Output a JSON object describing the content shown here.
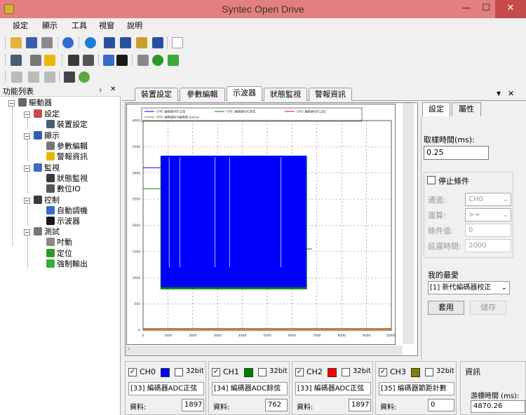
{
  "window": {
    "title": "Syntec Open Drive",
    "minimize": "—",
    "maximize": "☐",
    "close": "✕"
  },
  "menu": [
    "設定",
    "顯示",
    "工具",
    "視窗",
    "說明"
  ],
  "left_panel": {
    "title": "功能列表",
    "pin": "ₜ",
    "close": "✕",
    "tree": {
      "root": "驅動器",
      "groups": [
        {
          "label": "設定",
          "items": [
            "裝置設定"
          ]
        },
        {
          "label": "顯示",
          "items": [
            "參數編輯",
            "警報資訊"
          ]
        },
        {
          "label": "監視",
          "items": [
            "狀態監視",
            "數位IO"
          ]
        },
        {
          "label": "控制",
          "items": [
            "自動調機",
            "示波器"
          ]
        },
        {
          "label": "測試",
          "items": [
            "吋動",
            "定位",
            "強制輸出"
          ]
        }
      ]
    }
  },
  "doc_tabs": [
    "裝置設定",
    "參數編輯",
    "示波器",
    "狀態監視",
    "警報資訊"
  ],
  "doc_controls": {
    "dropdown": "▾",
    "close": "✕"
  },
  "oscilloscope": {
    "legend": [
      "CH0: 編碼器ADC正弦",
      "CH1: 編碼器ADC餘弦",
      "CH2: 編碼器ADC正弦",
      "CH3: 編碼器新代編碼器 (pulse)"
    ]
  },
  "chart_data": {
    "type": "line",
    "x_ticks": [
      0,
      1000,
      2000,
      3000,
      4000,
      5000,
      6000,
      7000,
      8000,
      9000,
      10000
    ],
    "y_ticks": [
      0,
      500,
      1000,
      1500,
      2000,
      2500,
      3000,
      3500,
      4000
    ],
    "xlim": [
      0,
      10000
    ],
    "ylim": [
      0,
      4000
    ],
    "grid": true,
    "legend_position": "top",
    "series": [
      {
        "name": "CH0",
        "color": "#0000ff",
        "x": [
          0,
          700,
          800,
          6500,
          6600
        ],
        "y": [
          3100,
          3100,
          800,
          3300,
          850
        ]
      },
      {
        "name": "CH1",
        "color": "#008000",
        "x": [
          0,
          700,
          800,
          6600,
          6800
        ],
        "y": [
          2700,
          2700,
          800,
          800,
          1550
        ]
      },
      {
        "name": "CH2",
        "color": "#ff0000",
        "x": [
          0,
          10000
        ],
        "y": [
          0,
          0
        ]
      },
      {
        "name": "CH3",
        "color": "#808000",
        "x": [
          0,
          10000
        ],
        "y": [
          30,
          30
        ]
      }
    ]
  },
  "right_panel": {
    "tabs": [
      "設定",
      "屬性"
    ],
    "sample_label": "取樣時間(ms):",
    "sample_value": "0.25",
    "stop_label": "停止條件",
    "channel_label": "通道:",
    "channel_value": "CH0",
    "op_label": "運算:",
    "op_value": ">=",
    "cond_label": "條件值:",
    "cond_value": "0",
    "delay_label": "延遲時間:",
    "delay_value": "2000",
    "fav_label": "我的最愛",
    "fav_value": "[1] 新代編碼器校正",
    "apply": "套用",
    "save": "儲存"
  },
  "channels": [
    {
      "name": "CH0",
      "color": "#0000ff",
      "bit": "32bit",
      "source": "[33] 編碼器ADC正弦",
      "data_label": "資料:",
      "value": "1897"
    },
    {
      "name": "CH1",
      "color": "#008000",
      "bit": "32bit",
      "source": "[34] 編碼器ADC餘弦",
      "data_label": "資料:",
      "value": "762"
    },
    {
      "name": "CH2",
      "color": "#ff0000",
      "bit": "32bit",
      "source": "[33] 編碼器ADC正弦",
      "data_label": "資料:",
      "value": "1897"
    },
    {
      "name": "CH3",
      "color": "#808000",
      "bit": "32bit",
      "source": "[35] 編碼器節距計數",
      "data_label": "資料:",
      "value": "0"
    }
  ],
  "info_panel": {
    "title": "資訊",
    "cursor_label": "游標時間 (ms):",
    "cursor_value": "4870.26"
  }
}
